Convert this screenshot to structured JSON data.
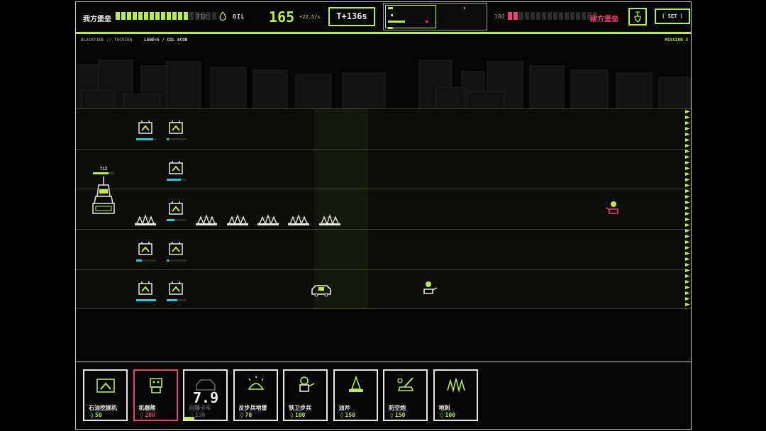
{
  "player": {
    "label": "我方堡垒",
    "hp": "712",
    "hp_segments_filled": 13,
    "hp_segments_total": 18
  },
  "enemy": {
    "label": "敌方堡垒",
    "hp": "100",
    "hp_segments_filled": 2,
    "hp_segments_total": 16
  },
  "oil": {
    "label": "OIL",
    "amount": "165",
    "rate": "+22.5/s"
  },
  "timer": "T+136s",
  "settings_label": "[ SET ]",
  "breadcrumb": {
    "left": "BLACKTIDE // TACVIEW",
    "mode": "LANE×5 / OIL ECON",
    "mission": "MISSION 3"
  },
  "base_hp_label": "712",
  "colors": {
    "accent": "#b8f03c",
    "enemy": "#f04070",
    "shield": "#27c7e0"
  },
  "cards": [
    {
      "name": "石油挖掘机",
      "cost": "50",
      "icon": "oil-drill-icon"
    },
    {
      "name": "机器熊",
      "cost": "200",
      "icon": "robot-bear-icon",
      "selected": true
    },
    {
      "name": "自爆卡车",
      "cost": "130",
      "icon": "bomb-truck-icon",
      "cooldown": "7.9"
    },
    {
      "name": "反步兵地雷",
      "cost": "70",
      "icon": "mine-icon"
    },
    {
      "name": "铁卫步兵",
      "cost": "100",
      "icon": "soldier-icon"
    },
    {
      "name": "油井",
      "cost": "150",
      "icon": "oil-well-icon"
    },
    {
      "name": "防空炮",
      "cost": "150",
      "icon": "aa-gun-icon"
    },
    {
      "name": "地刺",
      "cost": "100",
      "icon": "spikes-icon"
    }
  ]
}
